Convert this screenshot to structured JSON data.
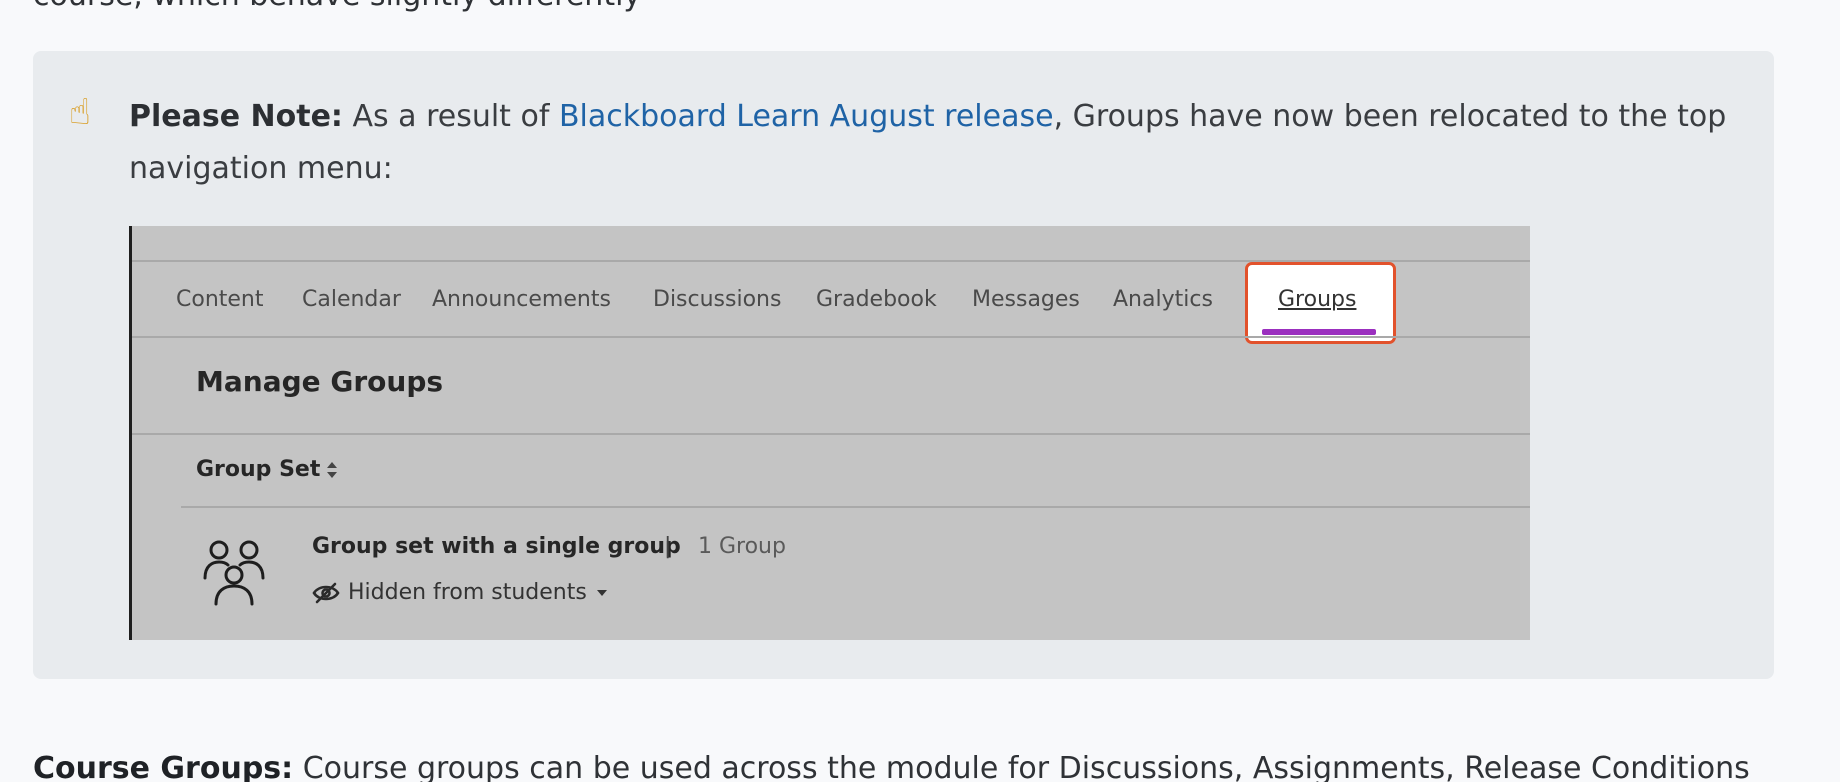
{
  "intro_text": "course, which behave slightly differently",
  "note": {
    "icon": "pointing-up-hand-icon",
    "label": "Please Note:",
    "text_before_link": " As a result of ",
    "link_text": "Blackboard Learn August release",
    "text_after_link": ", Groups have now been relocated to the top navigation menu:"
  },
  "screenshot": {
    "nav_tabs": [
      "Content",
      "Calendar",
      "Announcements",
      "Discussions",
      "Gradebook",
      "Messages",
      "Analytics",
      "Groups"
    ],
    "active_tab": "Groups",
    "page_title": "Manage Groups",
    "column_header": "Group Set",
    "group_set": {
      "name": "Group set with a single group",
      "separator": "|",
      "count": "1 Group",
      "visibility": "Hidden from students"
    }
  },
  "course_groups": {
    "label": "Course Groups:",
    "text": " Course groups can be used across the module for Discussions, Assignments, Release Conditions"
  },
  "colors": {
    "link": "#1f63a6",
    "highlight_border": "#e2522c",
    "active_underline": "#9b2fbf"
  }
}
